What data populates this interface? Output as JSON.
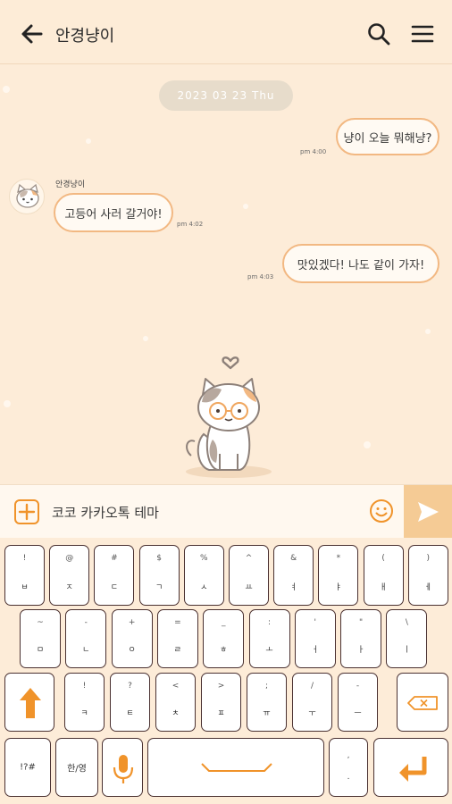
{
  "header": {
    "title": "안경냥이"
  },
  "chat": {
    "date": "2023 03 23 Thu",
    "sender_name": "안경냥이",
    "messages": [
      {
        "side": "right",
        "text": "냥이 오늘 뭐해냥?",
        "time": "pm 4:00"
      },
      {
        "side": "left",
        "text": "고등어 사러 갈거야!",
        "time": "pm 4:02"
      },
      {
        "side": "right",
        "text": "맛있겠다! 나도 같이 가자!",
        "time": "pm 4:03"
      }
    ]
  },
  "input": {
    "text": "코코 카카오톡 테마"
  },
  "keyboard": {
    "row1": [
      [
        "!",
        "ㅂ"
      ],
      [
        "@",
        "ㅈ"
      ],
      [
        "#",
        "ㄷ"
      ],
      [
        "$",
        "ㄱ"
      ],
      [
        "%",
        "ㅅ"
      ],
      [
        "^",
        "ㅛ"
      ],
      [
        "&",
        "ㅕ"
      ],
      [
        "*",
        "ㅑ"
      ],
      [
        "(",
        "ㅐ"
      ],
      [
        ")",
        "ㅔ"
      ]
    ],
    "row2": [
      [
        "~",
        "ㅁ"
      ],
      [
        "-",
        "ㄴ"
      ],
      [
        "+",
        "ㅇ"
      ],
      [
        "=",
        "ㄹ"
      ],
      [
        "_",
        "ㅎ"
      ],
      [
        ":",
        "ㅗ"
      ],
      [
        "'",
        "ㅓ"
      ],
      [
        "\"",
        "ㅏ"
      ],
      [
        "\\",
        "ㅣ"
      ]
    ],
    "row3": [
      [
        "!",
        "ㅋ"
      ],
      [
        "?",
        "ㅌ"
      ],
      [
        "<",
        "ㅊ"
      ],
      [
        ">",
        "ㅍ"
      ],
      [
        ";",
        "ㅠ"
      ],
      [
        "/",
        "ㅜ"
      ],
      [
        "-",
        "ㅡ"
      ]
    ],
    "symbols_label": "!?#",
    "lang_label": "한/영",
    "comma_label": ",",
    "period_label": "."
  },
  "colors": {
    "accent": "#f0932a",
    "bubble_border": "#f2b882",
    "background": "#fdecd8"
  }
}
